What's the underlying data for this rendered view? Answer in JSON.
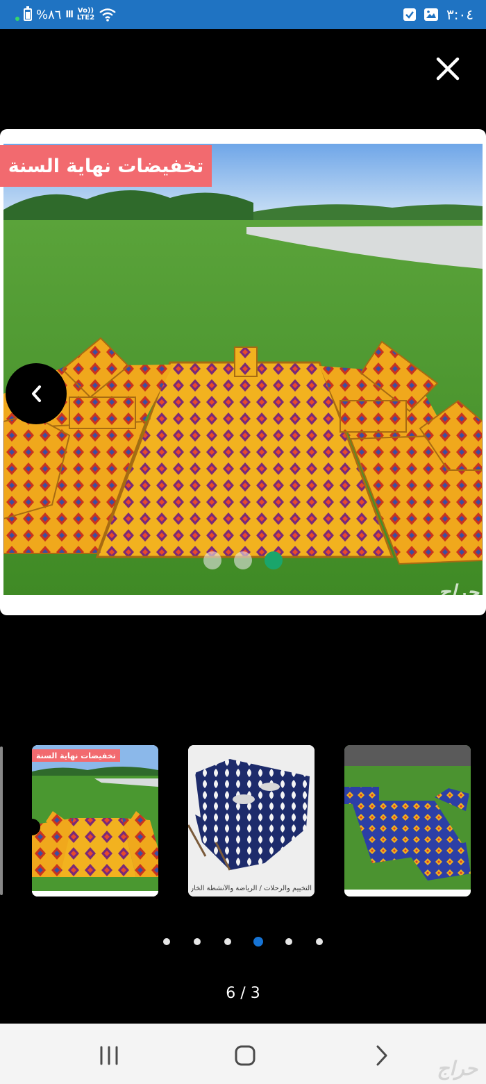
{
  "status_bar": {
    "battery_text": "%٨٦",
    "signal": "lll",
    "network": [
      "Vo))",
      "LTE2"
    ],
    "time": "٣:٠٤",
    "colors": {
      "background": "#1f73c2"
    }
  },
  "viewer": {
    "close_icon": "close-icon",
    "prev_icon": "chevron-left-icon",
    "main_image": {
      "banner_text": "تخفيضات نهاية السنة",
      "watermark": "حراج",
      "image_dots": {
        "count": 3,
        "active_index": 2
      }
    },
    "thumbnails": [
      {
        "banner_text": "تخفيضات نهاية السنة",
        "caption": ""
      },
      {
        "banner_text": "",
        "caption": "التخييم والرحلات  /  الرياضة والأنشطة الخارجية"
      },
      {
        "banner_text": "",
        "caption": ""
      }
    ],
    "pagination": {
      "count": 6,
      "active_index": 3
    },
    "counter": "6 / 3"
  },
  "nav_bar": {
    "recents_icon": "recents-icon",
    "home_icon": "home-icon",
    "back_icon": "back-icon",
    "watermark": "حراج"
  }
}
